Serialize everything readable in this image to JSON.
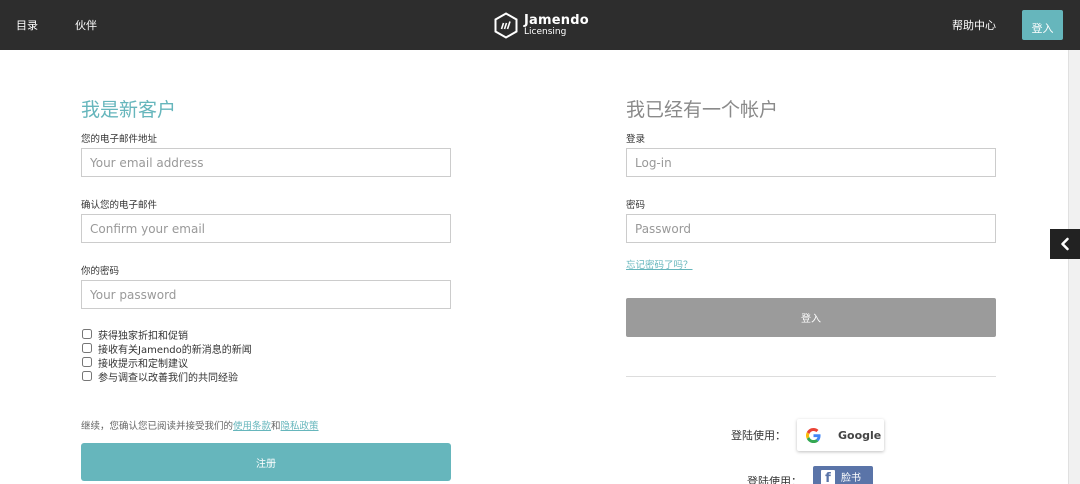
{
  "nav": {
    "catalog": "目录",
    "partners": "伙伴",
    "help": "帮助中心",
    "login_button": "登入"
  },
  "logo": {
    "name": "Jamendo",
    "subtitle": "Licensing"
  },
  "new_customer": {
    "title": "我是新客户",
    "email_label": "您的电子邮件地址",
    "email_placeholder": "Your email address",
    "confirm_label": "确认您的电子邮件",
    "confirm_placeholder": "Confirm your email",
    "password_label": "你的密码",
    "password_placeholder": "Your password",
    "checkboxes": [
      "获得独家折扣和促销",
      "接收有关Jamendo的新消息的新闻",
      "接收提示和定制建议",
      "参与调查以改善我们的共同经验"
    ],
    "terms_prefix": "继续，您确认您已阅读并接受我们的",
    "terms_link": "使用条款",
    "terms_and": "和",
    "privacy_link": "隐私政策",
    "register_button": "注册"
  },
  "existing_customer": {
    "title": "我已经有一个帐户",
    "login_label": "登录",
    "login_placeholder": "Log-in",
    "password_label": "密码",
    "password_placeholder": "Password",
    "forgot_link": "忘记密码了吗？",
    "login_button": "登入",
    "social_label_google": "登陆使用：",
    "google_button": "Google",
    "social_label_facebook": "登陆使用：",
    "facebook_button": "脸书"
  },
  "colors": {
    "accent": "#66b6bc",
    "topbar": "#2d2d2d",
    "login_button_gray": "#9b9b9b",
    "facebook": "#5a74a8"
  },
  "icons": {
    "logo": "jamendo-logo-icon",
    "side_toggle": "chevron-left-icon",
    "google": "google-g-icon",
    "facebook": "facebook-f-icon"
  }
}
